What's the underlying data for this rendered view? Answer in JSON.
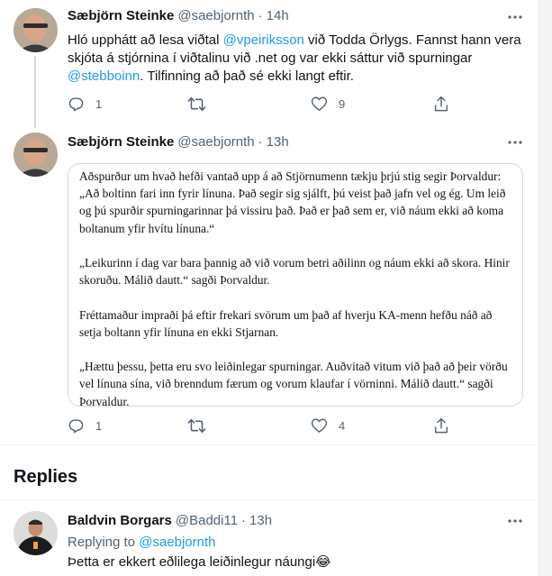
{
  "tweets": [
    {
      "author": "Sæbjörn Steinke",
      "handle": "@saebjornth",
      "time": "14h",
      "text_part1": "Hló upphátt að lesa viðtal ",
      "mention1": "@vpeiriksson",
      "text_part2": " við Todda Örlygs. Fannst hann vera skjóta á stjórnina í viðtalinu við .net og var ekki sáttur við spurningar ",
      "mention2": "@stebboinn",
      "text_part3": ". Tilfinning að það sé ekki langt eftir.",
      "reply_count": "1",
      "retweet_count": "",
      "like_count": "9"
    },
    {
      "author": "Sæbjörn Steinke",
      "handle": "@saebjornth",
      "time": "13h",
      "quote_paragraphs": [
        "Aðspurður um hvað hefði vantað upp á að Stjörnumenn tækju þrjú stig segir Þorvaldur: „Að boltinn fari inn fyrir línuna. Það segir sig sjálft, þú veist það jafn vel og ég. Um leið og þú spurðir spurningarinnar þá vissiru það. Það er það sem er, við náum ekki að koma boltanum yfir hvítu línuna.“",
        "„Leikurinn í dag var bara þannig að við vorum betri aðilinn og náum ekki að skora. Hinir skoruðu. Málið dautt.“ sagði Þorvaldur.",
        "Fréttamaður impraði þá eftir frekari svörum um það af hverju KA-menn hefðu náð að setja boltann yfir línuna en ekki Stjarnan.",
        "„Hættu þessu, þetta eru svo leiðinlegar spurningar. Auðvitað vitum við það að þeir vörðu vel línuna sína, við brenndum færum og vorum klaufar í vörninni. Málið dautt.“ sagði Þorvaldur."
      ],
      "reply_count": "1",
      "retweet_count": "",
      "like_count": "4"
    }
  ],
  "replies_heading": "Replies",
  "reply": {
    "author": "Baldvin Borgars",
    "handle": "@Baddi11",
    "time": "13h",
    "replying_to_label": "Replying to ",
    "replying_to_handle": "@saebjornth",
    "text": "Þetta er ekkert eðlilega leiðinlegur náungi😂"
  },
  "icons": {
    "reply": "reply-icon",
    "retweet": "retweet-icon",
    "like": "heart-icon",
    "share": "share-icon",
    "more": "more-icon"
  },
  "colors": {
    "text": "#0f1419",
    "secondary": "#536471",
    "accent": "#1d9bf0",
    "border": "#cfd9de"
  }
}
